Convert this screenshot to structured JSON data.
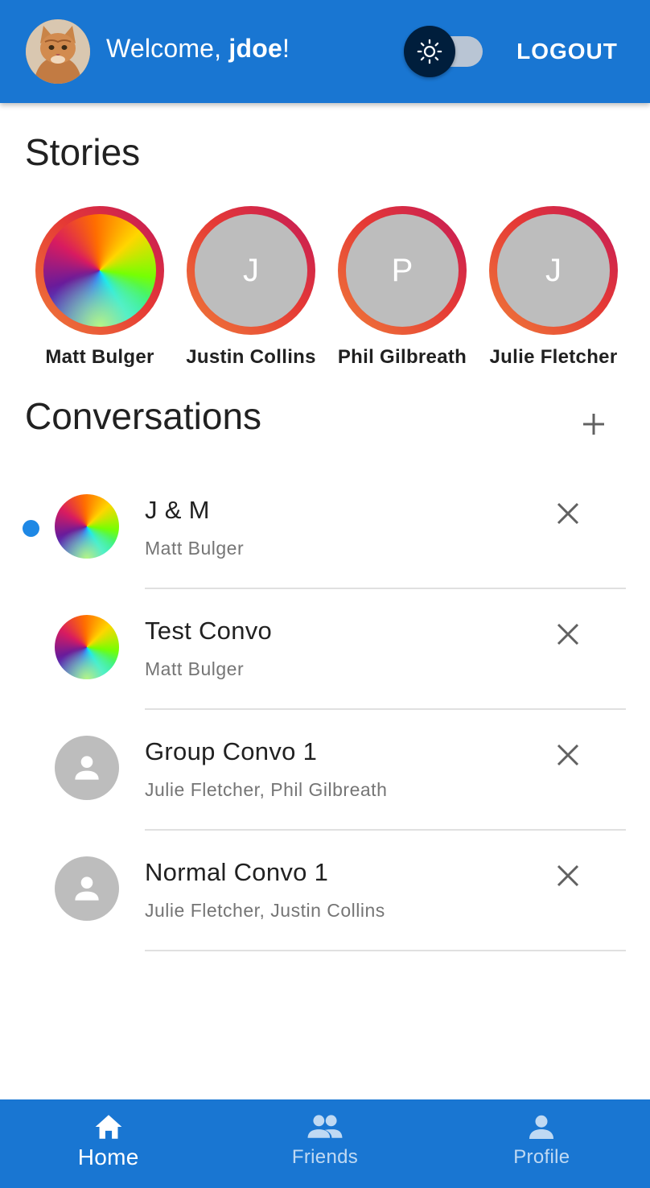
{
  "header": {
    "welcome_prefix": "Welcome, ",
    "username": "jdoe",
    "welcome_suffix": "!",
    "logout_label": "LOGOUT",
    "theme_toggle": {
      "icon": "sun-icon",
      "checked": false
    },
    "user_avatar": "cat-photo-avatar",
    "colors": {
      "bar": "#1976d2",
      "thumb": "#001e3c"
    }
  },
  "stories": {
    "title": "Stories",
    "items": [
      {
        "name": "Matt Bulger",
        "initial": "",
        "avatar": "rainbow-gradient"
      },
      {
        "name": "Justin Collins",
        "initial": "J",
        "avatar": "letter"
      },
      {
        "name": "Phil Gilbreath",
        "initial": "P",
        "avatar": "letter"
      },
      {
        "name": "Julie Fletcher",
        "initial": "J",
        "avatar": "letter"
      }
    ]
  },
  "conversations": {
    "title": "Conversations",
    "add_icon": "plus-icon",
    "items": [
      {
        "name": "J & M",
        "participants": "Matt Bulger",
        "unread": true,
        "avatar": "rainbow-gradient"
      },
      {
        "name": "Test Convo",
        "participants": "Matt Bulger",
        "unread": false,
        "avatar": "rainbow-gradient"
      },
      {
        "name": "Group Convo 1",
        "participants": "Julie Fletcher, Phil Gilbreath",
        "unread": false,
        "avatar": "person-placeholder"
      },
      {
        "name": "Normal Convo 1",
        "participants": "Julie Fletcher, Justin Collins",
        "unread": false,
        "avatar": "person-placeholder"
      }
    ]
  },
  "bottom_nav": {
    "items": [
      {
        "label": "Home",
        "icon": "home-icon",
        "active": true
      },
      {
        "label": "Friends",
        "icon": "people-icon",
        "active": false
      },
      {
        "label": "Profile",
        "icon": "person-icon",
        "active": false
      }
    ]
  }
}
